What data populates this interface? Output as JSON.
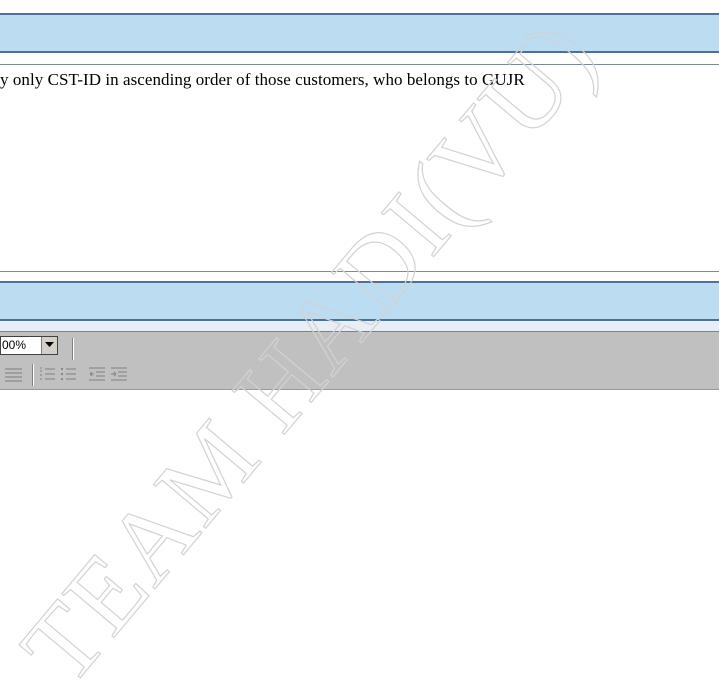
{
  "question": {
    "text": "y only CST-ID in ascending order of those customers, who belongs to GUJR"
  },
  "toolbar": {
    "zoom_value": "00%",
    "zoom_icon": "chevron-down-icon",
    "format_icons": [
      "align-justify-icon",
      "numbered-list-icon",
      "bulleted-list-icon",
      "decrease-indent-icon",
      "increase-indent-icon"
    ]
  },
  "watermark": {
    "text": "TEAM HADI(VU)"
  },
  "colors": {
    "band": "#bcdcf2",
    "band_border": "#4d7096",
    "toolbar": "#c0c0c0"
  }
}
